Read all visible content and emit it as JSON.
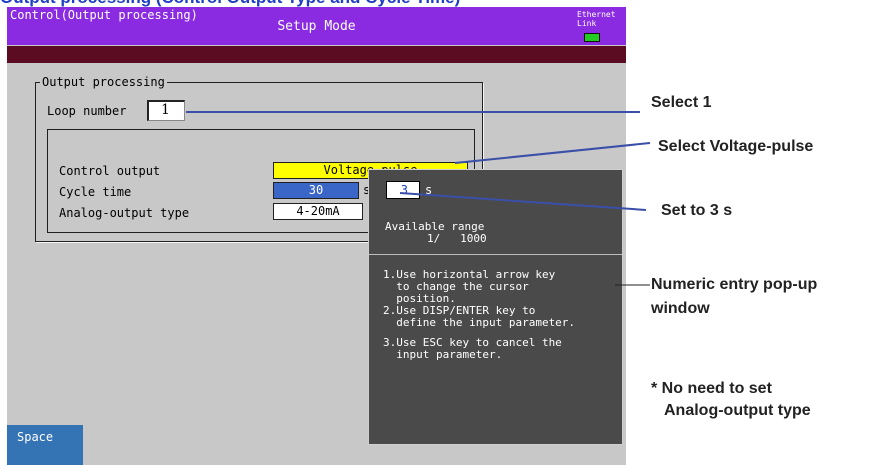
{
  "page_heading": "Output processing (Control Output Type and Cycle Time)",
  "header": {
    "title": "Setup Mode",
    "ethernet_label": "Ethernet",
    "link_label": "Link",
    "link_color": "#22cc22"
  },
  "menu": {
    "path": "Control(Output processing)"
  },
  "group": {
    "title": "Output processing",
    "loop_label": "Loop number",
    "loop_value": "1"
  },
  "settings": {
    "control_output_label": "Control output",
    "control_output_value": "Voltage-pulse",
    "cycle_time_label": "Cycle time",
    "cycle_time_value": "30",
    "cycle_time_unit": "s",
    "analog_output_label": "Analog-output type",
    "analog_output_value": "4-20mA"
  },
  "popup": {
    "input_value": "3",
    "unit": "s",
    "range_label": "Available range",
    "range_value": "1/   1000",
    "instruction_1": "1.Use horizontal arrow key\n  to change the cursor\n  position.",
    "instruction_2": "2.Use DISP/ENTER key to\n  define the input parameter.",
    "instruction_3": "3.Use ESC key to cancel the\n  input parameter."
  },
  "softkeys": {
    "space": "Space"
  },
  "annotations": {
    "select_loop": "Select 1",
    "select_output": "Select Voltage-pulse",
    "set_cycle": "Set to 3 s",
    "popup_line1": "Numeric entry pop-up",
    "popup_line2": "window",
    "note_line1": "* No need to set",
    "note_line2": "Analog-output type"
  },
  "colors": {
    "title_bar": "#8a2be2",
    "menu_bar": "#5b0c22",
    "selected_field": "#ffff00",
    "cursor_field": "#3a66c8",
    "popup_bg": "#4a4a4a",
    "heading_blue": "#1f3fc6"
  }
}
